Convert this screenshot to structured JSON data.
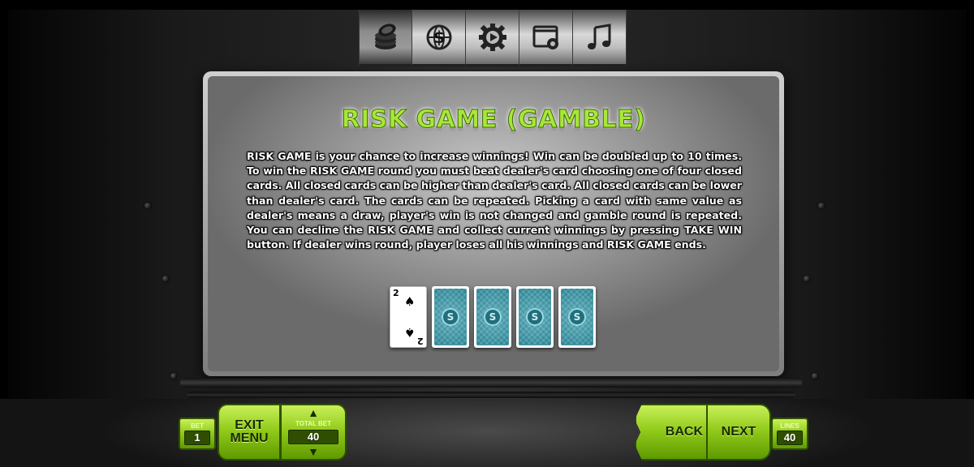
{
  "tabs": [
    {
      "icon": "coins-icon",
      "active": true
    },
    {
      "icon": "currency-globe-icon",
      "active": false
    },
    {
      "icon": "autoplay-gear-icon",
      "active": false
    },
    {
      "icon": "window-settings-icon",
      "active": false
    },
    {
      "icon": "music-note-icon",
      "active": false
    }
  ],
  "panel": {
    "title": "RISK GAME (GAMBLE)",
    "body": "RISK GAME is your chance to increase winnings! Win can be doubled up to 10 times. To win the RISK GAME round you must beat dealer's card choosing one of four closed cards. All closed cards can be higher than dealer's card. All closed cards can be lower than dealer's card. The cards can be repeated. Picking a card with same value as dealer's means a draw, player's win is not changed and gamble round is repeated. You can decline the RISK GAME and collect current winnings by pressing TAKE WIN button. If dealer wins round, player loses all his winnings and RISK GAME ends."
  },
  "cards": {
    "open": {
      "rank": "2",
      "suit": "♠"
    },
    "closed_count": 4,
    "back_logo": "S"
  },
  "controls": {
    "bet_label": "BET",
    "bet_value": "1",
    "exit_line1": "EXIT",
    "exit_line2": "MENU",
    "total_bet_label": "TOTAL BET",
    "total_bet_value": "40",
    "back_label": "BACK",
    "next_label": "NEXT",
    "lines_label": "LINES",
    "lines_value": "40"
  },
  "colors": {
    "accent_green": "#93cc1c",
    "title_green": "#a8e63a",
    "card_back": "#2c8c9c"
  }
}
